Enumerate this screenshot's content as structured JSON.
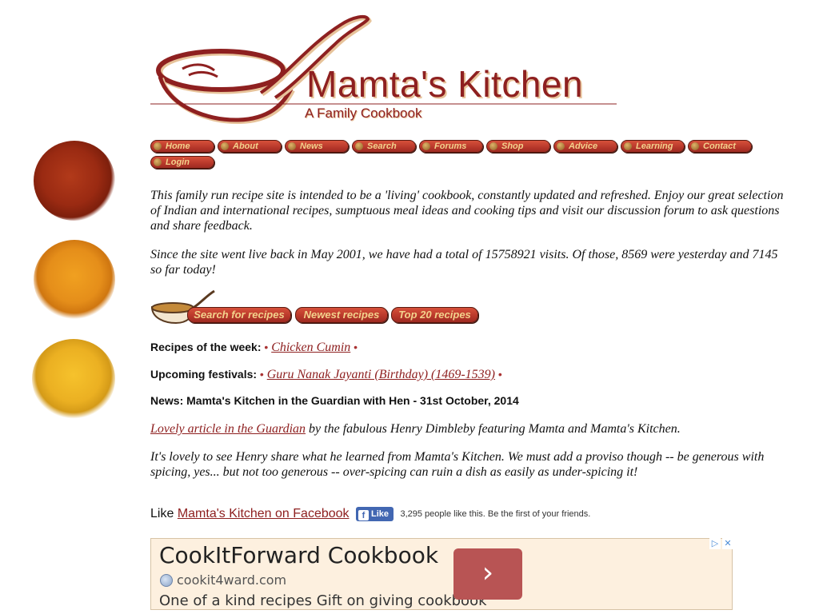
{
  "logo": {
    "title": "Mamta's Kitchen",
    "subtitle": "A Family Cookbook"
  },
  "nav": [
    "Home",
    "About",
    "News",
    "Search",
    "Forums",
    "Shop",
    "Advice",
    "Learning",
    "Contact",
    "Login"
  ],
  "intro": "This family run recipe site is intended to be a 'living' cookbook, constantly updated and refreshed. Enjoy our great selection of Indian and international recipes, sumptuous meal ideas and cooking tips and visit our discussion forum to ask questions and share feedback.",
  "visits": "Since the site went live back in May 2001, we have had a total of 15758921 visits. Of those, 8569 were yesterday and 7145 so far today!",
  "recipe_buttons": [
    "Search for recipes",
    "Newest recipes",
    "Top 20 recipes"
  ],
  "recipes_week": {
    "label": "Recipes of the week:",
    "bullet": "•",
    "link": "Chicken Cumin"
  },
  "festivals": {
    "label": "Upcoming festivals:",
    "bullet": "•",
    "link": "Guru Nanak Jayanti (Birthday) (1469-1539)"
  },
  "news_heading": "News: Mamta's Kitchen in the Guardian with Hen - 31st October, 2014",
  "news_para1": {
    "link": "Lovely article in the Guardian",
    "text": " by the fabulous Henry Dimbleby featuring Mamta and Mamta's Kitchen."
  },
  "news_para2": "It's lovely to see Henry share what he learned from Mamta's Kitchen. We must add a proviso though -- be generous with spicing, yes... but not too generous -- over-spicing can ruin a dish as easily as under-spicing it!",
  "facebook": {
    "prefix": "Like",
    "link": "Mamta's Kitchen on Facebook",
    "like_label": "Like",
    "fb_letter": "f",
    "count_text": "3,295 people like this. Be the first of your friends."
  },
  "ad": {
    "title": "CookItForward Cookbook",
    "url": "cookit4ward.com",
    "desc": "One of a kind recipes Gift on giving cookbook",
    "arrow": "›",
    "adchoices": "▷",
    "close": "✕"
  },
  "colors": {
    "brand": "#8e2020",
    "button": "#b7372a",
    "button_text": "#f3d28c",
    "ad_bg": "#fdf0df",
    "ad_arrow": "#b85454"
  }
}
